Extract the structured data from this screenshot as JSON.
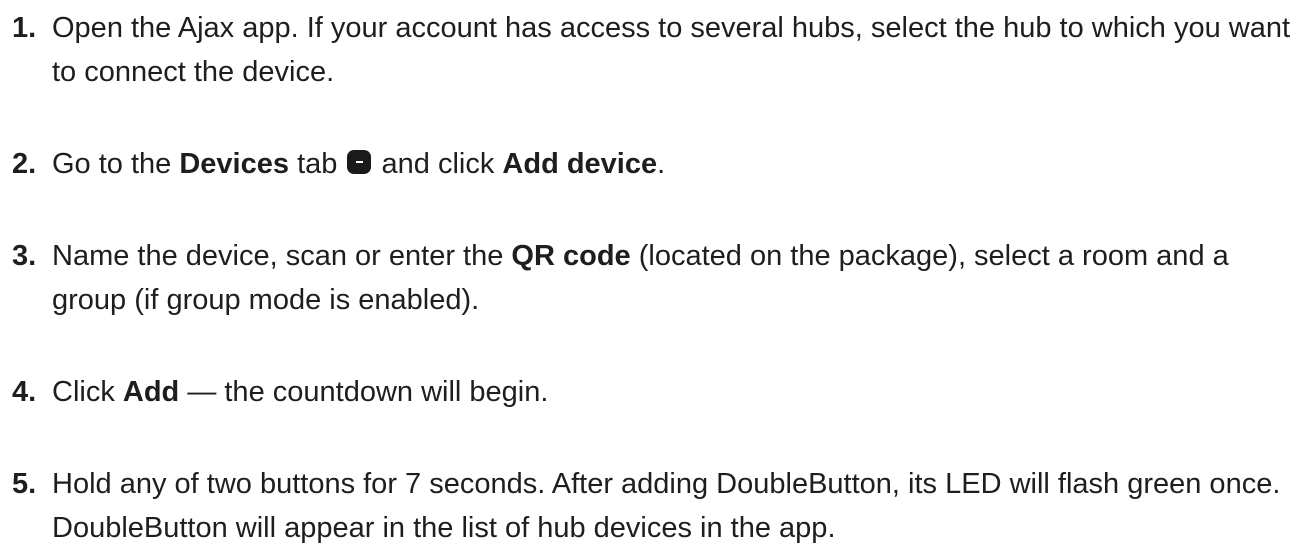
{
  "steps": [
    {
      "number": "1.",
      "text": "Open the Ajax app. If your account has access to several hubs, select the hub to which you want to connect the device."
    },
    {
      "number": "2.",
      "parts": {
        "a": "Go to the ",
        "b": "Devices",
        "c": " tab ",
        "d": " and click ",
        "e": "Add device",
        "f": "."
      },
      "icon": "devices-tab-icon"
    },
    {
      "number": "3.",
      "parts": {
        "a": "Name the device, scan or enter the ",
        "b": "QR code",
        "c": " (located on the package), select a room and a group (if group mode is enabled)."
      }
    },
    {
      "number": "4.",
      "parts": {
        "a": "Click ",
        "b": "Add",
        "c": " — the countdown will begin."
      }
    },
    {
      "number": "5.",
      "text": "Hold any of two buttons for 7 seconds. After adding DoubleButton, its LED will flash green once. DoubleButton will appear in the list of hub devices in the app."
    }
  ]
}
